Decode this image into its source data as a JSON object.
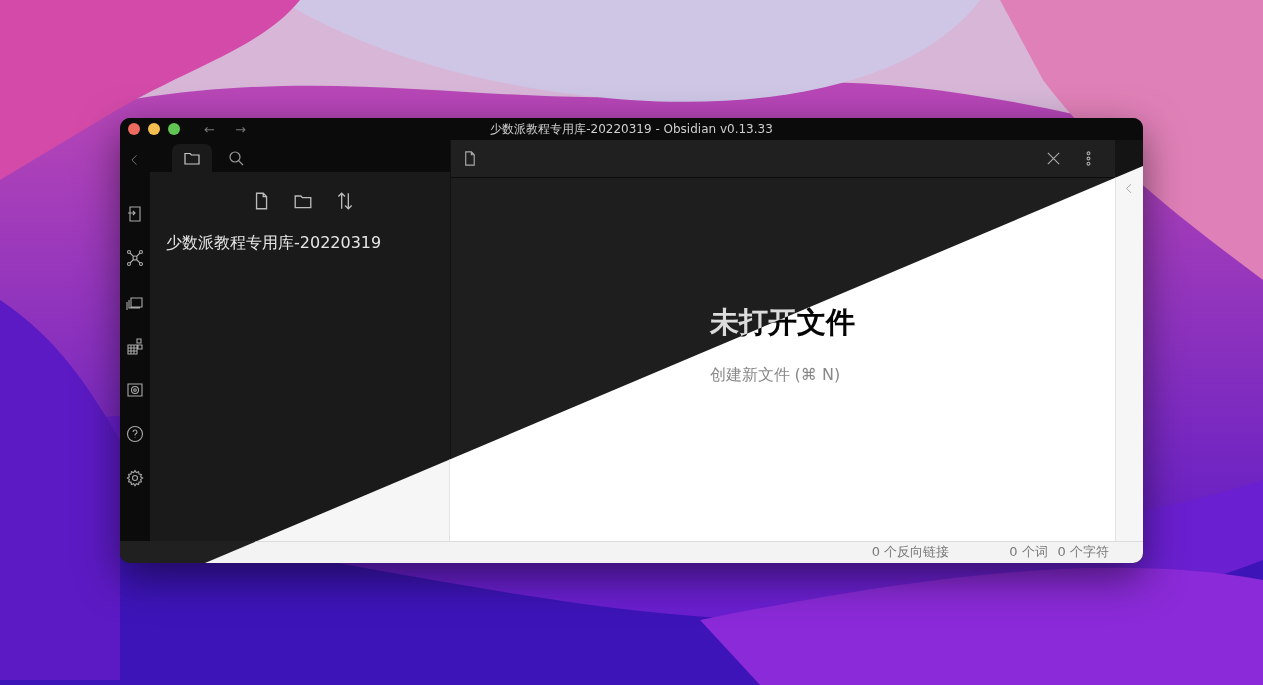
{
  "window": {
    "title": "少数派教程专用库-20220319 - Obsidian v0.13.33",
    "nav_back": "←",
    "nav_forward": "→"
  },
  "file_pane": {
    "tabs": [
      {
        "kind": "files",
        "selected": true
      },
      {
        "kind": "search",
        "selected": false
      }
    ],
    "vault_name": "少数派教程专用库-20220319"
  },
  "editor": {
    "heading": "未打开文件",
    "hint": "创建新文件 (⌘ N)"
  },
  "status_bar": [
    {
      "text": "0 个反向链接"
    },
    {
      "text": "0 个词"
    },
    {
      "text": "0 个字符"
    }
  ]
}
